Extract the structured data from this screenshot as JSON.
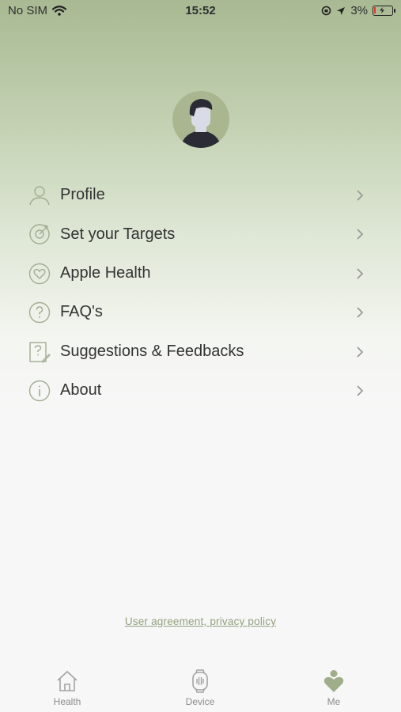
{
  "status_bar": {
    "carrier": "No SIM",
    "time": "15:52",
    "battery": "3%"
  },
  "menu": {
    "items": [
      {
        "label": "Profile",
        "icon": "person-icon"
      },
      {
        "label": "Set your Targets",
        "icon": "target-icon"
      },
      {
        "label": "Apple Health",
        "icon": "heart-icon"
      },
      {
        "label": "FAQ's",
        "icon": "question-icon"
      },
      {
        "label": "Suggestions & Feedbacks",
        "icon": "feedback-icon"
      },
      {
        "label": "About",
        "icon": "info-icon"
      }
    ]
  },
  "footer": {
    "link": "User agreement, privacy policy"
  },
  "tabbar": {
    "tabs": [
      {
        "label": "Health",
        "icon": "house-icon",
        "active": false
      },
      {
        "label": "Device",
        "icon": "watch-icon",
        "active": false
      },
      {
        "label": "Me",
        "icon": "person-heart-icon",
        "active": true
      }
    ]
  },
  "colors": {
    "accent": "#93a07f",
    "avatar_bg": "#a9b68f",
    "icon": "#a3ad94"
  }
}
